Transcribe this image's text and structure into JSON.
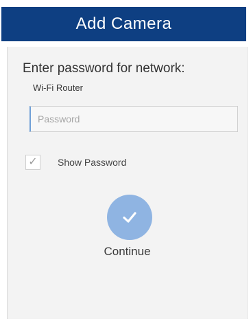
{
  "header": {
    "title": "Add Camera"
  },
  "form": {
    "prompt": "Enter password for network:",
    "network_name": "Wi-Fi Router",
    "password_placeholder": "Password",
    "password_value": "",
    "show_password_label": "Show Password",
    "show_password_checked": true,
    "continue_label": "Continue"
  },
  "icons": {
    "checkbox_mark": "checkmark-icon",
    "continue_icon": "checkmark-icon"
  },
  "colors": {
    "header_bg": "#0e3f82",
    "continue_button": "#8fb4e2",
    "panel_bg": "#f3f3f3"
  }
}
